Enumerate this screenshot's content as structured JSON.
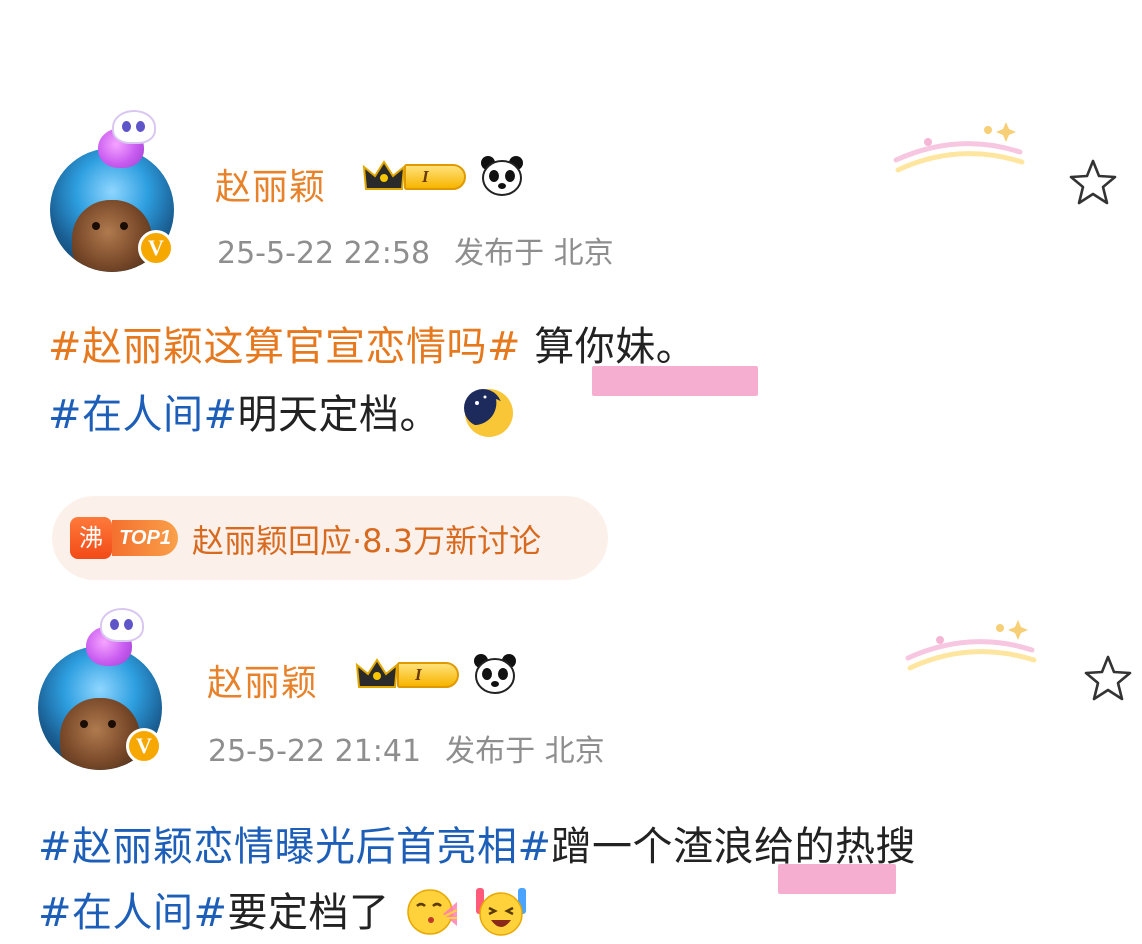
{
  "posts": [
    {
      "user": {
        "name": "赵丽颖",
        "level": "I",
        "verified": "V",
        "icons": [
          "crown-icon",
          "level-badge",
          "panda-icon",
          "star-icon"
        ]
      },
      "meta": {
        "date": "25-5-22 22:58",
        "location": "发布于 北京"
      },
      "lines": [
        {
          "tag": "#赵丽颖这算官宣恋情吗#",
          "text": " 算你妹。"
        },
        {
          "tag": "#在人间#",
          "text": "明天定档。",
          "emoji": "moon-face-emoji"
        }
      ],
      "hot": {
        "icon_char": "沸",
        "rank": "TOP1",
        "text": "赵丽颖回应·8.3万新讨论"
      }
    },
    {
      "user": {
        "name": "赵丽颖",
        "level": "I",
        "verified": "V",
        "icons": [
          "crown-icon",
          "level-badge",
          "panda-icon",
          "star-icon"
        ]
      },
      "meta": {
        "date": "25-5-22 21:41",
        "location": "发布于 北京"
      },
      "lines": [
        {
          "tag": "#赵丽颖恋情曝光后首亮相#",
          "text": "蹭一个渣浪给的热搜"
        },
        {
          "tag": "#在人间#",
          "text": "要定档了",
          "emoji": [
            "blowing-kiss-emoji",
            "party-face-emoji"
          ]
        }
      ]
    }
  ],
  "colors": {
    "name": "#e8822a",
    "tag_orange": "#e6781e",
    "tag_blue": "#1d5fb8",
    "meta": "#8e8e8e",
    "highlight": "#f4a0c8",
    "hot_bg": "#fcf1ea"
  }
}
